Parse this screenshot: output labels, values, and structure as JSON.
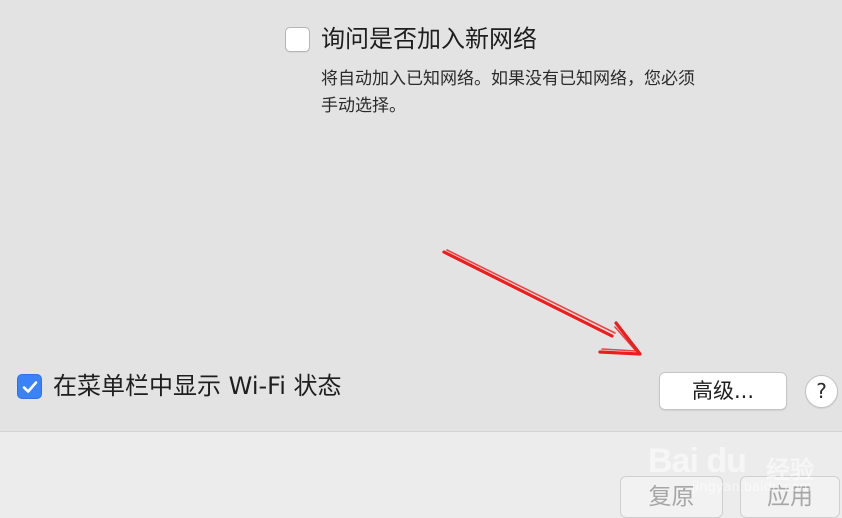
{
  "network_settings": {
    "ask_to_join": {
      "label": "询问是否加入新网络",
      "checked": false,
      "description_lines": [
        "将自动加入已知网络。如果没有已知网络，您必须",
        "手动选择。"
      ]
    },
    "show_wifi_status": {
      "label": "在菜单栏中显示 Wi-Fi 状态",
      "checked": true
    },
    "advanced_button_label": "高级...",
    "help_button_label": "?"
  },
  "footer": {
    "revert_label": "复原",
    "apply_label": "应用",
    "buttons_enabled": false
  },
  "watermark": {
    "logo": "Bai du",
    "brand": "经验",
    "url": "jingyan.baidu.com"
  },
  "colors": {
    "checkbox_checked": "#3a82f7",
    "annotation_arrow": "#ee1c1c",
    "background": "#e3e3e3"
  }
}
